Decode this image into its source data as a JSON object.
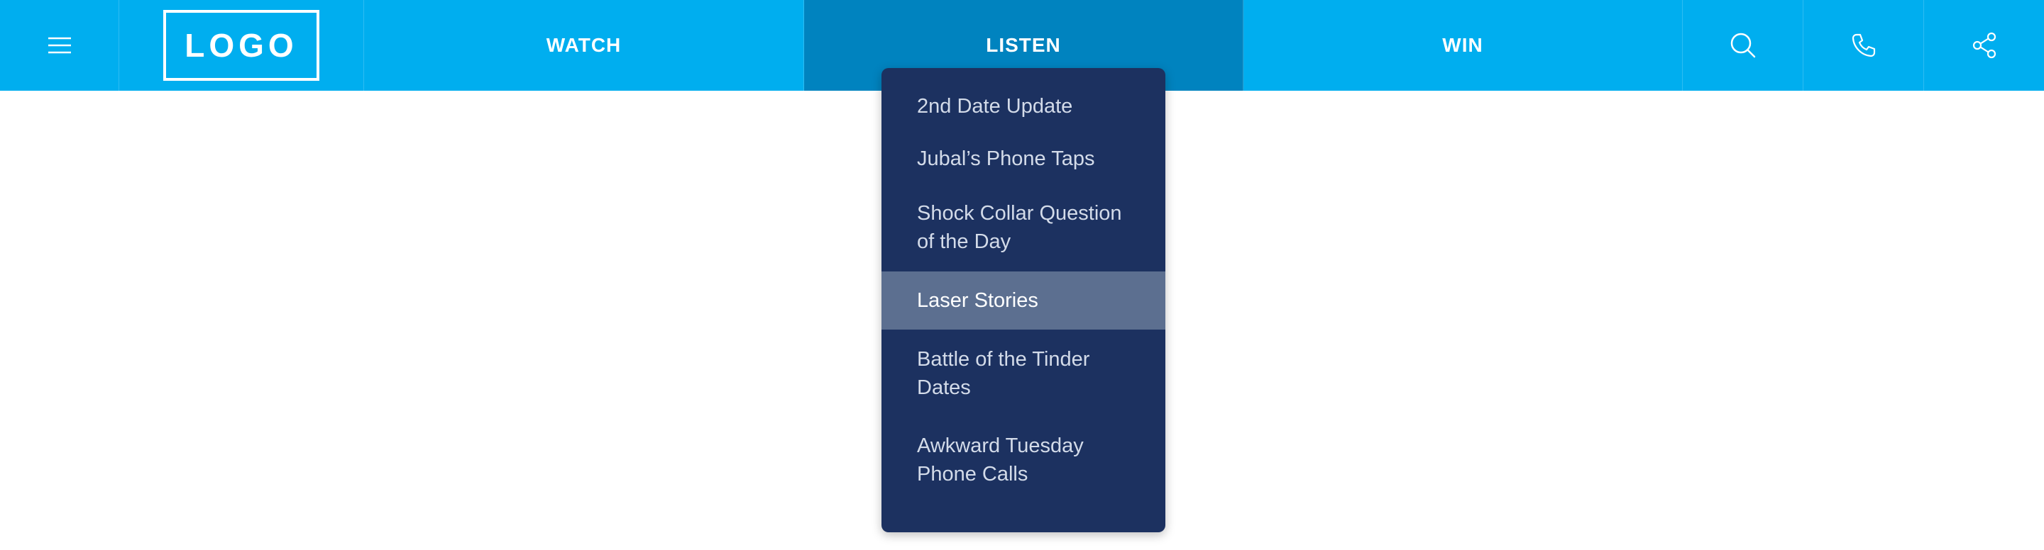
{
  "nav": {
    "logo_text": "LOGO",
    "watch_label": "WATCH",
    "listen_label": "LISTEN",
    "win_label": "WIN",
    "icons": {
      "menu": "hamburger-menu-icon",
      "search": "search-icon",
      "phone": "phone-icon",
      "share": "share-icon"
    }
  },
  "dropdown": {
    "items": [
      {
        "label": "2nd Date Update"
      },
      {
        "label": "Jubal’s Phone Taps"
      },
      {
        "label": "Shock Collar Question of the Day"
      },
      {
        "label": "Laser Stories",
        "highlighted": true
      },
      {
        "label": "Battle of the Tinder Dates"
      },
      {
        "label": "Awkward Tuesday Phone Calls"
      }
    ]
  },
  "colors": {
    "nav_background": "#00aeef",
    "nav_active": "#0083bf",
    "dropdown_background": "#1c3160",
    "dropdown_highlight": "#5c6f90"
  }
}
